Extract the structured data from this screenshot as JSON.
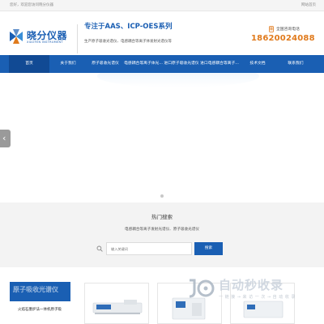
{
  "topbar": {
    "welcome": "您好，欢迎您访问晓分仪器",
    "homepage_link": "网站首页"
  },
  "brand": {
    "name": "晓分仪器",
    "name_en": "XIAOFEN INSTRUMENT",
    "logo_icon": "xiaofen-logo-icon",
    "brand_color": "#1b5fb3"
  },
  "header": {
    "slogan": "专注于AAS、ICP-OES系列",
    "sub_slogan": "生产原子吸收光谱仪、电感耦合等离子体发射光谱仪等",
    "hotline_label": "全国咨询电话",
    "hotline_number": "18620024088",
    "hotline_color": "#e07a1c"
  },
  "nav": {
    "bg_color": "#1a5fb3",
    "items": [
      {
        "label": "首页",
        "active": true
      },
      {
        "label": "关于我们"
      },
      {
        "label": "原子吸收光谱仪"
      },
      {
        "label": "电感耦合等离子体光..."
      },
      {
        "label": "进口原子吸收光谱仪"
      },
      {
        "label": "进口电感耦合等离子..."
      },
      {
        "label": "技术文档"
      },
      {
        "label": "联系我们"
      }
    ]
  },
  "banner": {
    "prev_arrow": "‹",
    "prev_icon": "chevron-left-icon",
    "slide_count": 1
  },
  "hot_search": {
    "title": "热门搜索",
    "keywords": "电感耦合等离子发射光谱仪、原子吸收光谱仪",
    "placeholder": "输入关键词",
    "button": "搜索",
    "icon": "search-icon"
  },
  "products": {
    "category_title": "原子吸收光谱仪",
    "category_item": "火焰石墨炉法一体机原子吸"
  },
  "watermark": {
    "title": "自动秒收录",
    "tagline": "一 链 接 → 来 访 一 次 → 自 动 收 录",
    "icon": "watermark-logo-icon"
  }
}
